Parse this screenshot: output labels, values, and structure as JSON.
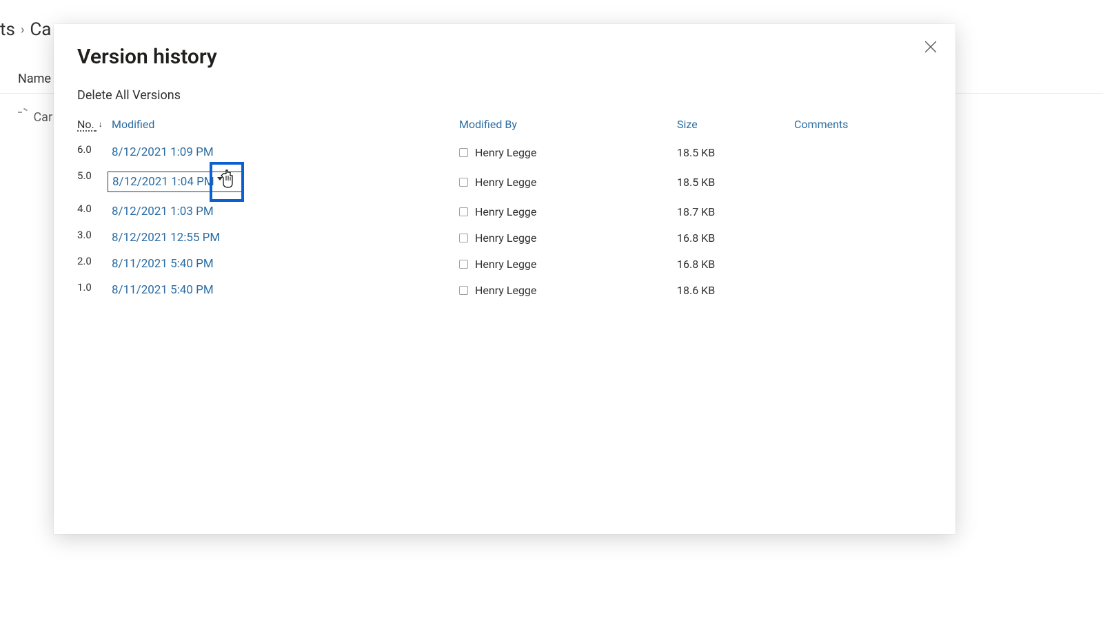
{
  "background": {
    "breadcrumb_fragment_1": "ts",
    "breadcrumb_fragment_2": "Ca",
    "column_name": "Name",
    "row_fragment": "Car typ"
  },
  "modal": {
    "title": "Version history",
    "delete_all": "Delete All Versions",
    "columns": {
      "no": "No.",
      "modified": "Modified",
      "modified_by": "Modified By",
      "size": "Size",
      "comments": "Comments"
    },
    "rows": [
      {
        "no": "6.0",
        "modified": "8/12/2021 1:09 PM",
        "by": "Henry Legge",
        "size": "18.5 KB",
        "comments": ""
      },
      {
        "no": "5.0",
        "modified": "8/12/2021 1:04 PM",
        "by": "Henry Legge",
        "size": "18.5 KB",
        "comments": ""
      },
      {
        "no": "4.0",
        "modified": "8/12/2021 1:03 PM",
        "by": "Henry Legge",
        "size": "18.7 KB",
        "comments": ""
      },
      {
        "no": "3.0",
        "modified": "8/12/2021 12:55 PM",
        "by": "Henry Legge",
        "size": "16.8 KB",
        "comments": ""
      },
      {
        "no": "2.0",
        "modified": "8/11/2021 5:40 PM",
        "by": "Henry Legge",
        "size": "16.8 KB",
        "comments": ""
      },
      {
        "no": "1.0",
        "modified": "8/11/2021 5:40 PM",
        "by": "Henry Legge",
        "size": "18.6 KB",
        "comments": ""
      }
    ]
  }
}
